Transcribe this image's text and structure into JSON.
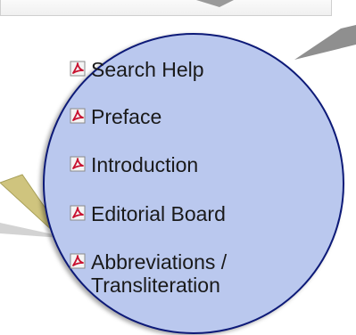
{
  "colors": {
    "bubble_fill": "#bac8ee",
    "bubble_border": "#0d1a78",
    "pointer_gray": "#8f8f8f",
    "pointer_yellow": "#c9c07a",
    "pdf_icon_red": "#c8102e"
  },
  "menu": {
    "items": [
      {
        "label": "Search Help",
        "icon": "pdf-icon"
      },
      {
        "label": "Preface",
        "icon": "pdf-icon"
      },
      {
        "label": "Introduction",
        "icon": "pdf-icon"
      },
      {
        "label": "Editorial Board",
        "icon": "pdf-icon"
      },
      {
        "label": "Abbreviations / Transliteration",
        "icon": "pdf-icon"
      }
    ]
  }
}
